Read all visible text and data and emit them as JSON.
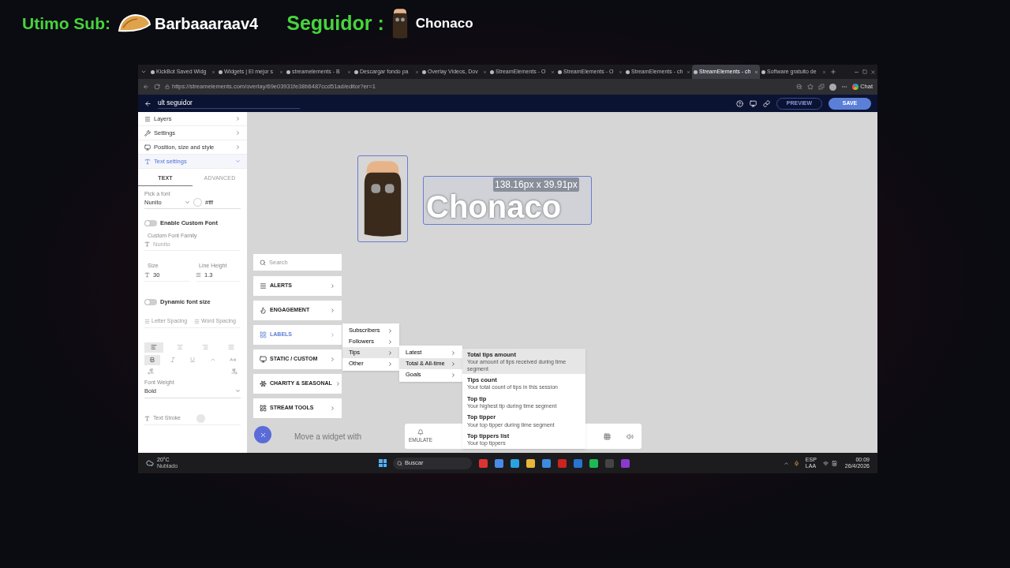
{
  "overlay": {
    "sub_label": "Utimo Sub:",
    "sub_name": "Barbaaaraav4",
    "follower_label": "Seguidor :",
    "follower_name": "Chonaco"
  },
  "browser": {
    "tabs": [
      {
        "title": "KickBot Saved Widg",
        "selected": false
      },
      {
        "title": "Widgets | El mejor s",
        "selected": false
      },
      {
        "title": "streamelements - B",
        "selected": false
      },
      {
        "title": "Descargar fondo pa",
        "selected": false
      },
      {
        "title": "Overlay Videos, Dov",
        "selected": false
      },
      {
        "title": "StreamElements - O",
        "selected": false
      },
      {
        "title": "StreamElements - O",
        "selected": false
      },
      {
        "title": "StreamElements - ch",
        "selected": false
      },
      {
        "title": "StreamElements - ch",
        "selected": true
      },
      {
        "title": "Software gratuito de",
        "selected": false
      }
    ],
    "url": "https://streamelements.com/overlay/69e03931fe38b6487ccd51ad/editor?er=1",
    "chat": "Chat"
  },
  "editor": {
    "title": "ult seguidor",
    "preview": "PREVIEW",
    "save": "SAVE"
  },
  "sidebar": {
    "sections": [
      {
        "label": "Layers",
        "expanded": false
      },
      {
        "label": "Settings",
        "expanded": false
      },
      {
        "label": "Position, size and style",
        "expanded": false
      },
      {
        "label": "Text settings",
        "expanded": true
      }
    ],
    "tabs": [
      {
        "label": "TEXT",
        "selected": true
      },
      {
        "label": "ADVANCED",
        "selected": false
      }
    ],
    "font": {
      "label": "Pick a font",
      "value": "Nunito",
      "color": "#fff"
    },
    "custom_font": {
      "label": "Enable Custom Font",
      "on": false
    },
    "custom_font_family": {
      "label": "Custom Font Family",
      "placeholder": "Nunito"
    },
    "size": {
      "label": "Size",
      "value": "30"
    },
    "line_height": {
      "label": "Line Height",
      "value": "1.3"
    },
    "dynamic_size": {
      "label": "Dynamic font size",
      "on": false
    },
    "letter_spacing": {
      "placeholder": "Letter Spacing"
    },
    "word_spacing": {
      "placeholder": "Word Spacing"
    },
    "alignments": [
      {
        "selected": true
      },
      {
        "selected": false
      },
      {
        "selected": false
      },
      {
        "selected": false
      }
    ],
    "formats": [
      {
        "selected": true
      },
      {
        "selected": false
      },
      {
        "selected": false
      },
      {
        "selected": false
      },
      {
        "selected": false
      }
    ],
    "font_weight": {
      "label": "Font Weight",
      "value": "Bold"
    },
    "text_stroke": {
      "label": "Text Stroke"
    }
  },
  "canvas": {
    "widget_text": "Chonaco",
    "size_readout": "138.16px x 39.91px",
    "hint": "Move a widget with",
    "emulate": "EMULATE"
  },
  "widget_menu": {
    "search": {
      "placeholder": "Search"
    },
    "categories": [
      {
        "label": "ALERTS",
        "selected": false
      },
      {
        "label": "ENGAGEMENT",
        "selected": false
      },
      {
        "label": "LABELS",
        "selected": true
      },
      {
        "label": "STATIC / CUSTOM",
        "selected": false
      },
      {
        "label": "CHARITY & SEASONAL",
        "selected": false
      },
      {
        "label": "STREAM TOOLS",
        "selected": false
      }
    ],
    "label_types": [
      {
        "label": "Subscribers",
        "selected": false
      },
      {
        "label": "Followers",
        "selected": false
      },
      {
        "label": "Tips",
        "selected": true
      },
      {
        "label": "Other",
        "selected": false
      }
    ],
    "tip_groups": [
      {
        "label": "Latest",
        "selected": false
      },
      {
        "label": "Total & All-time",
        "selected": true
      },
      {
        "label": "Goals",
        "selected": false
      }
    ],
    "widgets": [
      {
        "title": "Total tips amount",
        "description": "Your amount of tips received during time segment",
        "selected": true
      },
      {
        "title": "Tips count",
        "description": "Your total count of tips in this session",
        "selected": false
      },
      {
        "title": "Top tip",
        "description": "Your highest tip during time segment",
        "selected": false
      },
      {
        "title": "Top tipper",
        "description": "Your top tipper during time segment",
        "selected": false
      },
      {
        "title": "Top tippers list",
        "description": "Your top tippers",
        "selected": false
      }
    ]
  },
  "taskbar": {
    "temperature": "20°C",
    "weather": "Nublado",
    "search": "Buscar",
    "language": "ESP",
    "layout": "LAA",
    "time": "00:09",
    "date": "26/4/2026"
  }
}
